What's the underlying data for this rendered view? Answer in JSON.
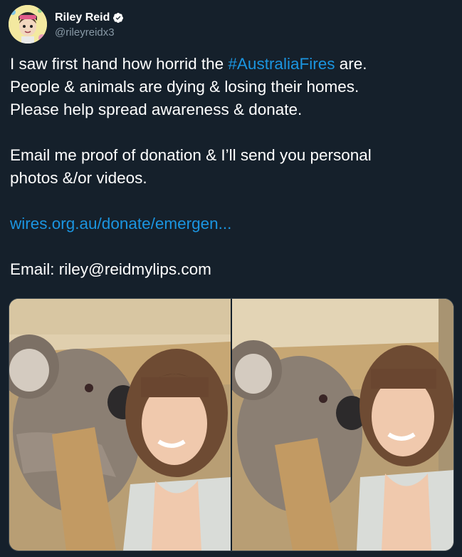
{
  "author": {
    "display_name": "Riley Reid",
    "handle": "@rileyreidx3",
    "verified": true,
    "avatar_icon": "cartoon-avatar-icon"
  },
  "tweet": {
    "line1_pre": "I saw first hand how horrid the ",
    "hashtag": "#AustraliaFires",
    "line1_post": " are.",
    "line2": "People & animals are dying & losing their homes.",
    "line3": "Please help spread awareness & donate.",
    "line4": "Email me proof of donation & I’ll send you personal",
    "line5": "photos &/or videos.",
    "link": "wires.org.au/donate/emergen...",
    "email_line": "Email: riley@reidmylips.com"
  },
  "media": {
    "count": 2,
    "photo_icon": "koala-selfie-photo"
  },
  "colors": {
    "background": "#15202b",
    "link": "#1b95e0",
    "handle": "#8899a6",
    "verified": "#1da1f2"
  }
}
